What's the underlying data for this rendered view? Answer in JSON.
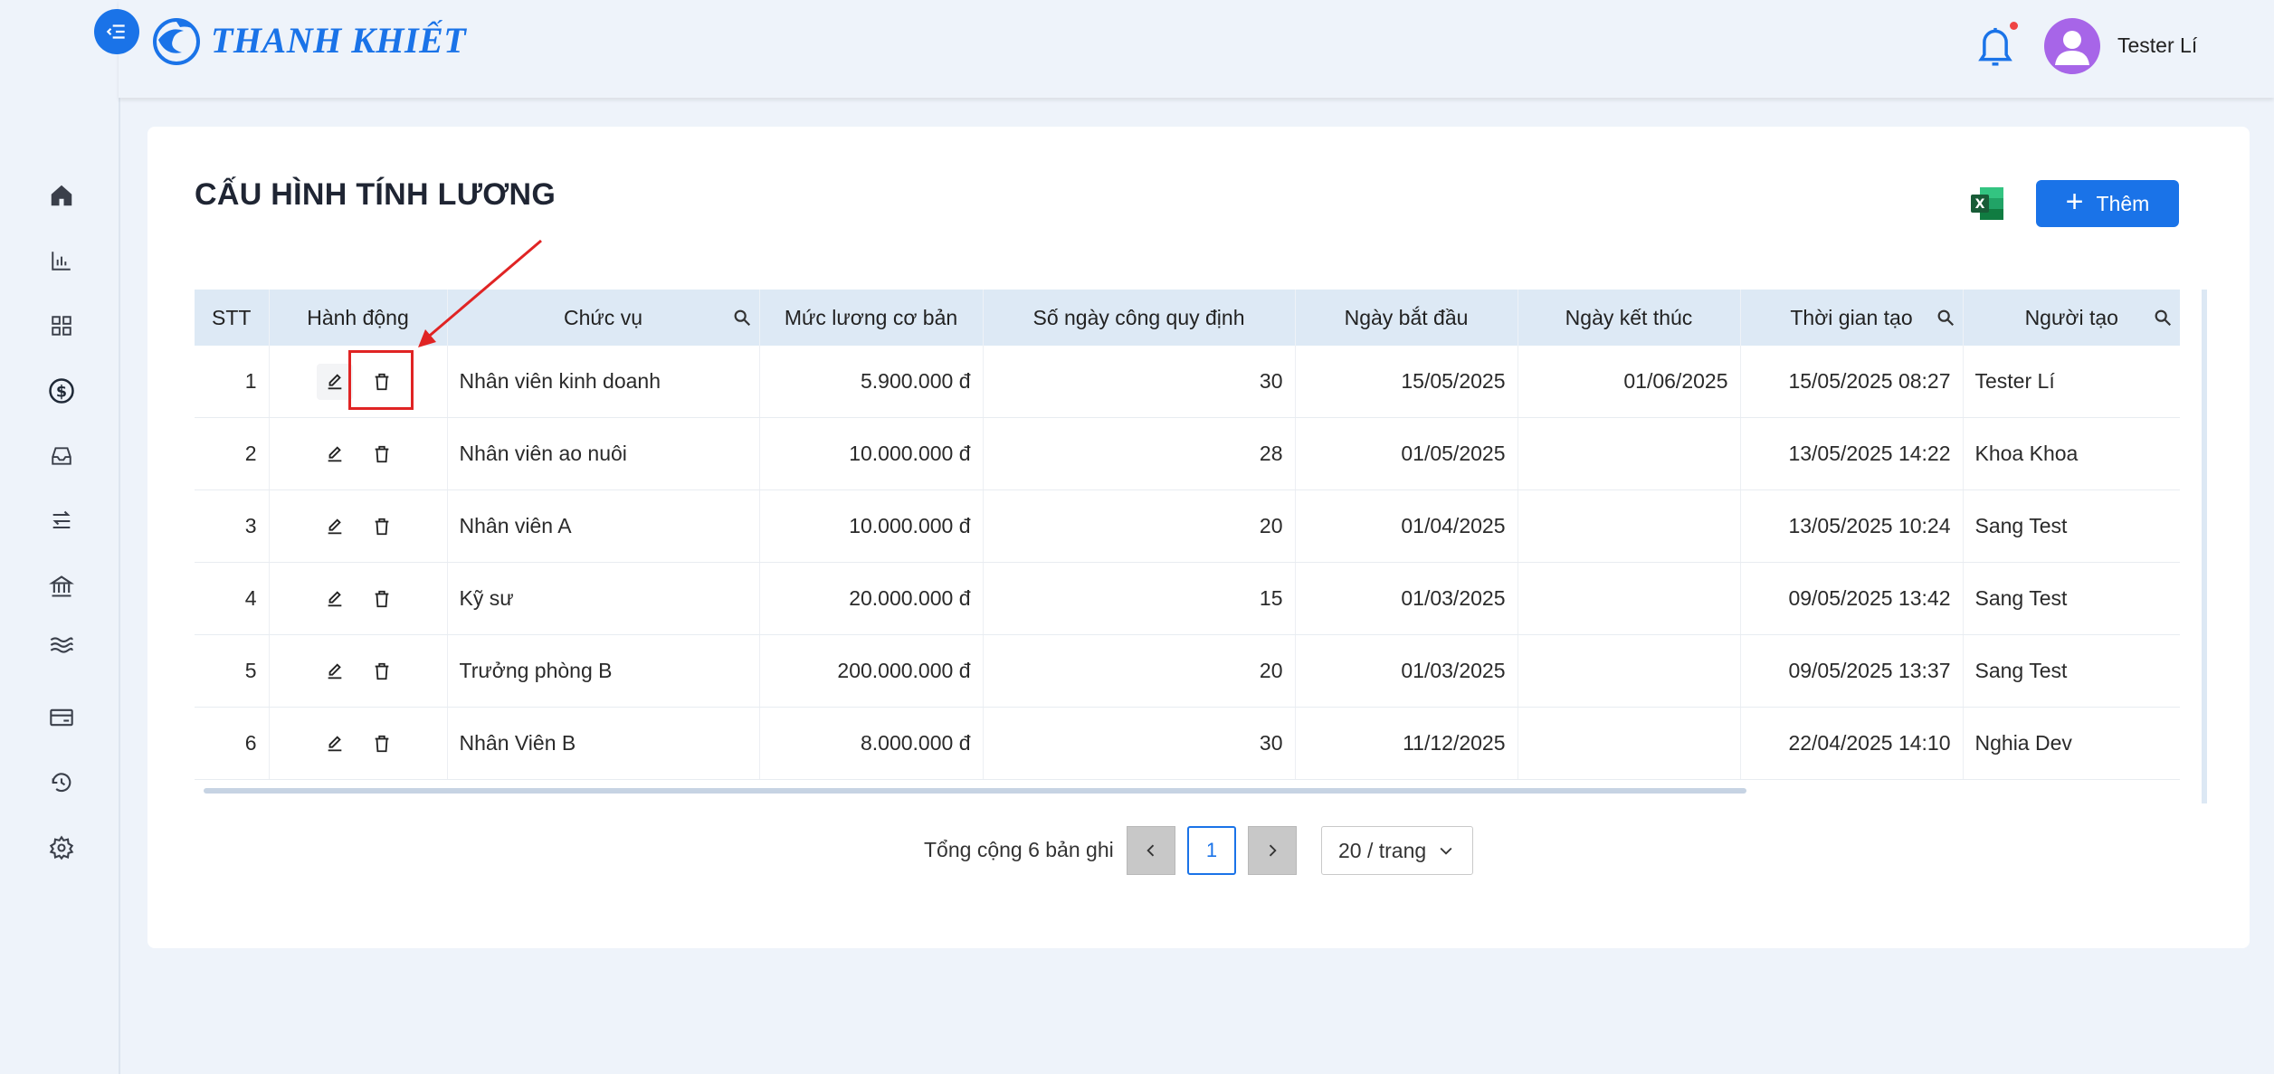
{
  "app": {
    "brand": "THANH KHIẾT"
  },
  "header": {
    "user_name": "Tester Lí",
    "has_notification": true
  },
  "sidebar": {
    "items": [
      {
        "icon": "home-icon"
      },
      {
        "icon": "bar-chart-icon"
      },
      {
        "icon": "grid-icon"
      },
      {
        "icon": "dollar-circle-icon"
      },
      {
        "icon": "inbox-icon"
      },
      {
        "icon": "transfer-icon"
      },
      {
        "icon": "bank-icon"
      },
      {
        "icon": "waves-icon"
      },
      {
        "icon": "credit-card-icon"
      },
      {
        "icon": "history-icon"
      },
      {
        "icon": "settings-icon"
      }
    ]
  },
  "page": {
    "title": "CẤU HÌNH TÍNH LƯƠNG",
    "add_label": "Thêm"
  },
  "table": {
    "columns": [
      "STT",
      "Hành động",
      "Chức vụ",
      "Mức lương cơ bản",
      "Số ngày công quy định",
      "Ngày bắt đầu",
      "Ngày kết thúc",
      "Thời gian tạo",
      "Người tạo"
    ],
    "rows": [
      {
        "stt": "1",
        "position": "Nhân viên kinh doanh",
        "salary": "5.900.000 đ",
        "days": "30",
        "start": "15/05/2025",
        "end": "01/06/2025",
        "created": "15/05/2025 08:27",
        "creator": "Tester Lí"
      },
      {
        "stt": "2",
        "position": "Nhân viên ao nuôi",
        "salary": "10.000.000 đ",
        "days": "28",
        "start": "01/05/2025",
        "end": "",
        "created": "13/05/2025 14:22",
        "creator": "Khoa Khoa"
      },
      {
        "stt": "3",
        "position": "Nhân viên A",
        "salary": "10.000.000 đ",
        "days": "20",
        "start": "01/04/2025",
        "end": "",
        "created": "13/05/2025 10:24",
        "creator": "Sang Test"
      },
      {
        "stt": "4",
        "position": "Kỹ sư",
        "salary": "20.000.000 đ",
        "days": "15",
        "start": "01/03/2025",
        "end": "",
        "created": "09/05/2025 13:42",
        "creator": "Sang Test"
      },
      {
        "stt": "5",
        "position": "Trưởng phòng B",
        "salary": "200.000.000 đ",
        "days": "20",
        "start": "01/03/2025",
        "end": "",
        "created": "09/05/2025 13:37",
        "creator": "Sang Test"
      },
      {
        "stt": "6",
        "position": "Nhân Viên B",
        "salary": "8.000.000 đ",
        "days": "30",
        "start": "11/12/2025",
        "end": "",
        "created": "22/04/2025 14:10",
        "creator": "Nghia Dev"
      }
    ]
  },
  "pagination": {
    "total_text": "Tổng cộng 6 bản ghi",
    "current_page": "1",
    "page_size": "20 / trang"
  },
  "colors": {
    "primary": "#1a73e8",
    "highlight": "#e02424",
    "header_bg": "#dde9f5"
  }
}
